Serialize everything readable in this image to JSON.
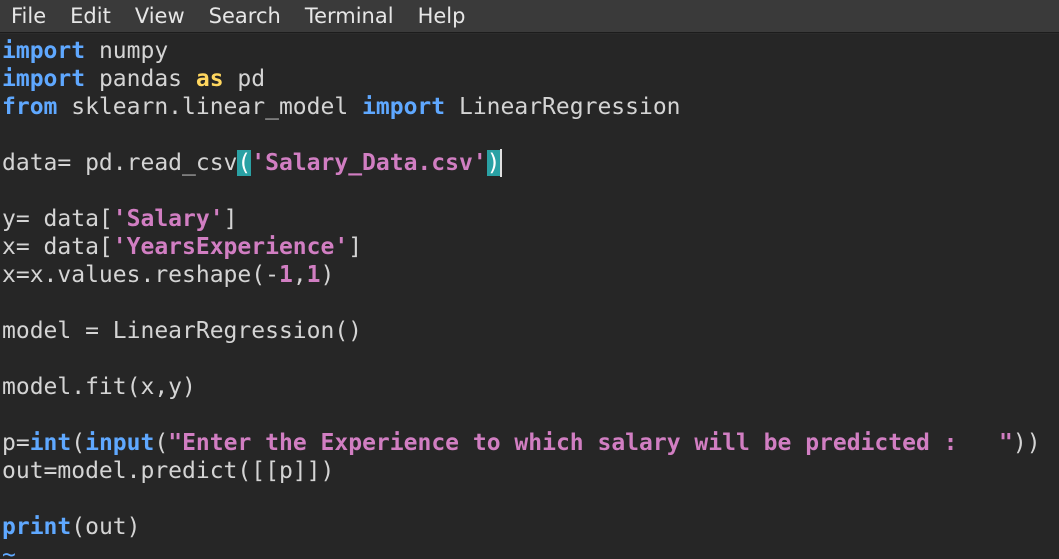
{
  "menu": {
    "items": [
      "File",
      "Edit",
      "View",
      "Search",
      "Terminal",
      "Help"
    ]
  },
  "colors": {
    "menubar_bg": "#3a3a3a",
    "editor_bg": "#262626",
    "keyword": "#5fa8ff",
    "as_keyword": "#ffd75f",
    "string": "#d17ec2",
    "bracket_highlight": "#2aa1a4"
  },
  "code": {
    "l1": {
      "kw": "import",
      "rest": " numpy"
    },
    "l2": {
      "kw": "import",
      "mid": " pandas ",
      "kw2": "as",
      "rest": " pd"
    },
    "l3": {
      "kw": "from",
      "mid": " sklearn.linear_model ",
      "kw2": "import",
      "rest": " LinearRegression"
    },
    "l5": {
      "pre": "data= pd.read_csv",
      "open": "(",
      "str": "'Salary_Data.csv'",
      "close": ")"
    },
    "l7": {
      "pre": "y= data[",
      "str": "'Salary'",
      "post": "]"
    },
    "l8": {
      "pre": "x= data[",
      "str": "'YearsExperience'",
      "post": "]"
    },
    "l9": {
      "pre": "x=x.values.reshape(-",
      "n1": "1",
      "comma": ",",
      "n2": "1",
      "post": ")"
    },
    "l11": {
      "text": "model = LinearRegression()"
    },
    "l13": {
      "text": "model.fit(x,y)"
    },
    "l15": {
      "pre": "p=",
      "fn1": "int",
      "p1": "(",
      "fn2": "input",
      "p2": "(",
      "str": "\"Enter the Experience to which salary will be predicted :   \"",
      "post": "))"
    },
    "l16": {
      "text": "out=model.predict([[p]])"
    },
    "l18": {
      "fn": "print",
      "post": "(out)"
    },
    "tilde": "~"
  }
}
